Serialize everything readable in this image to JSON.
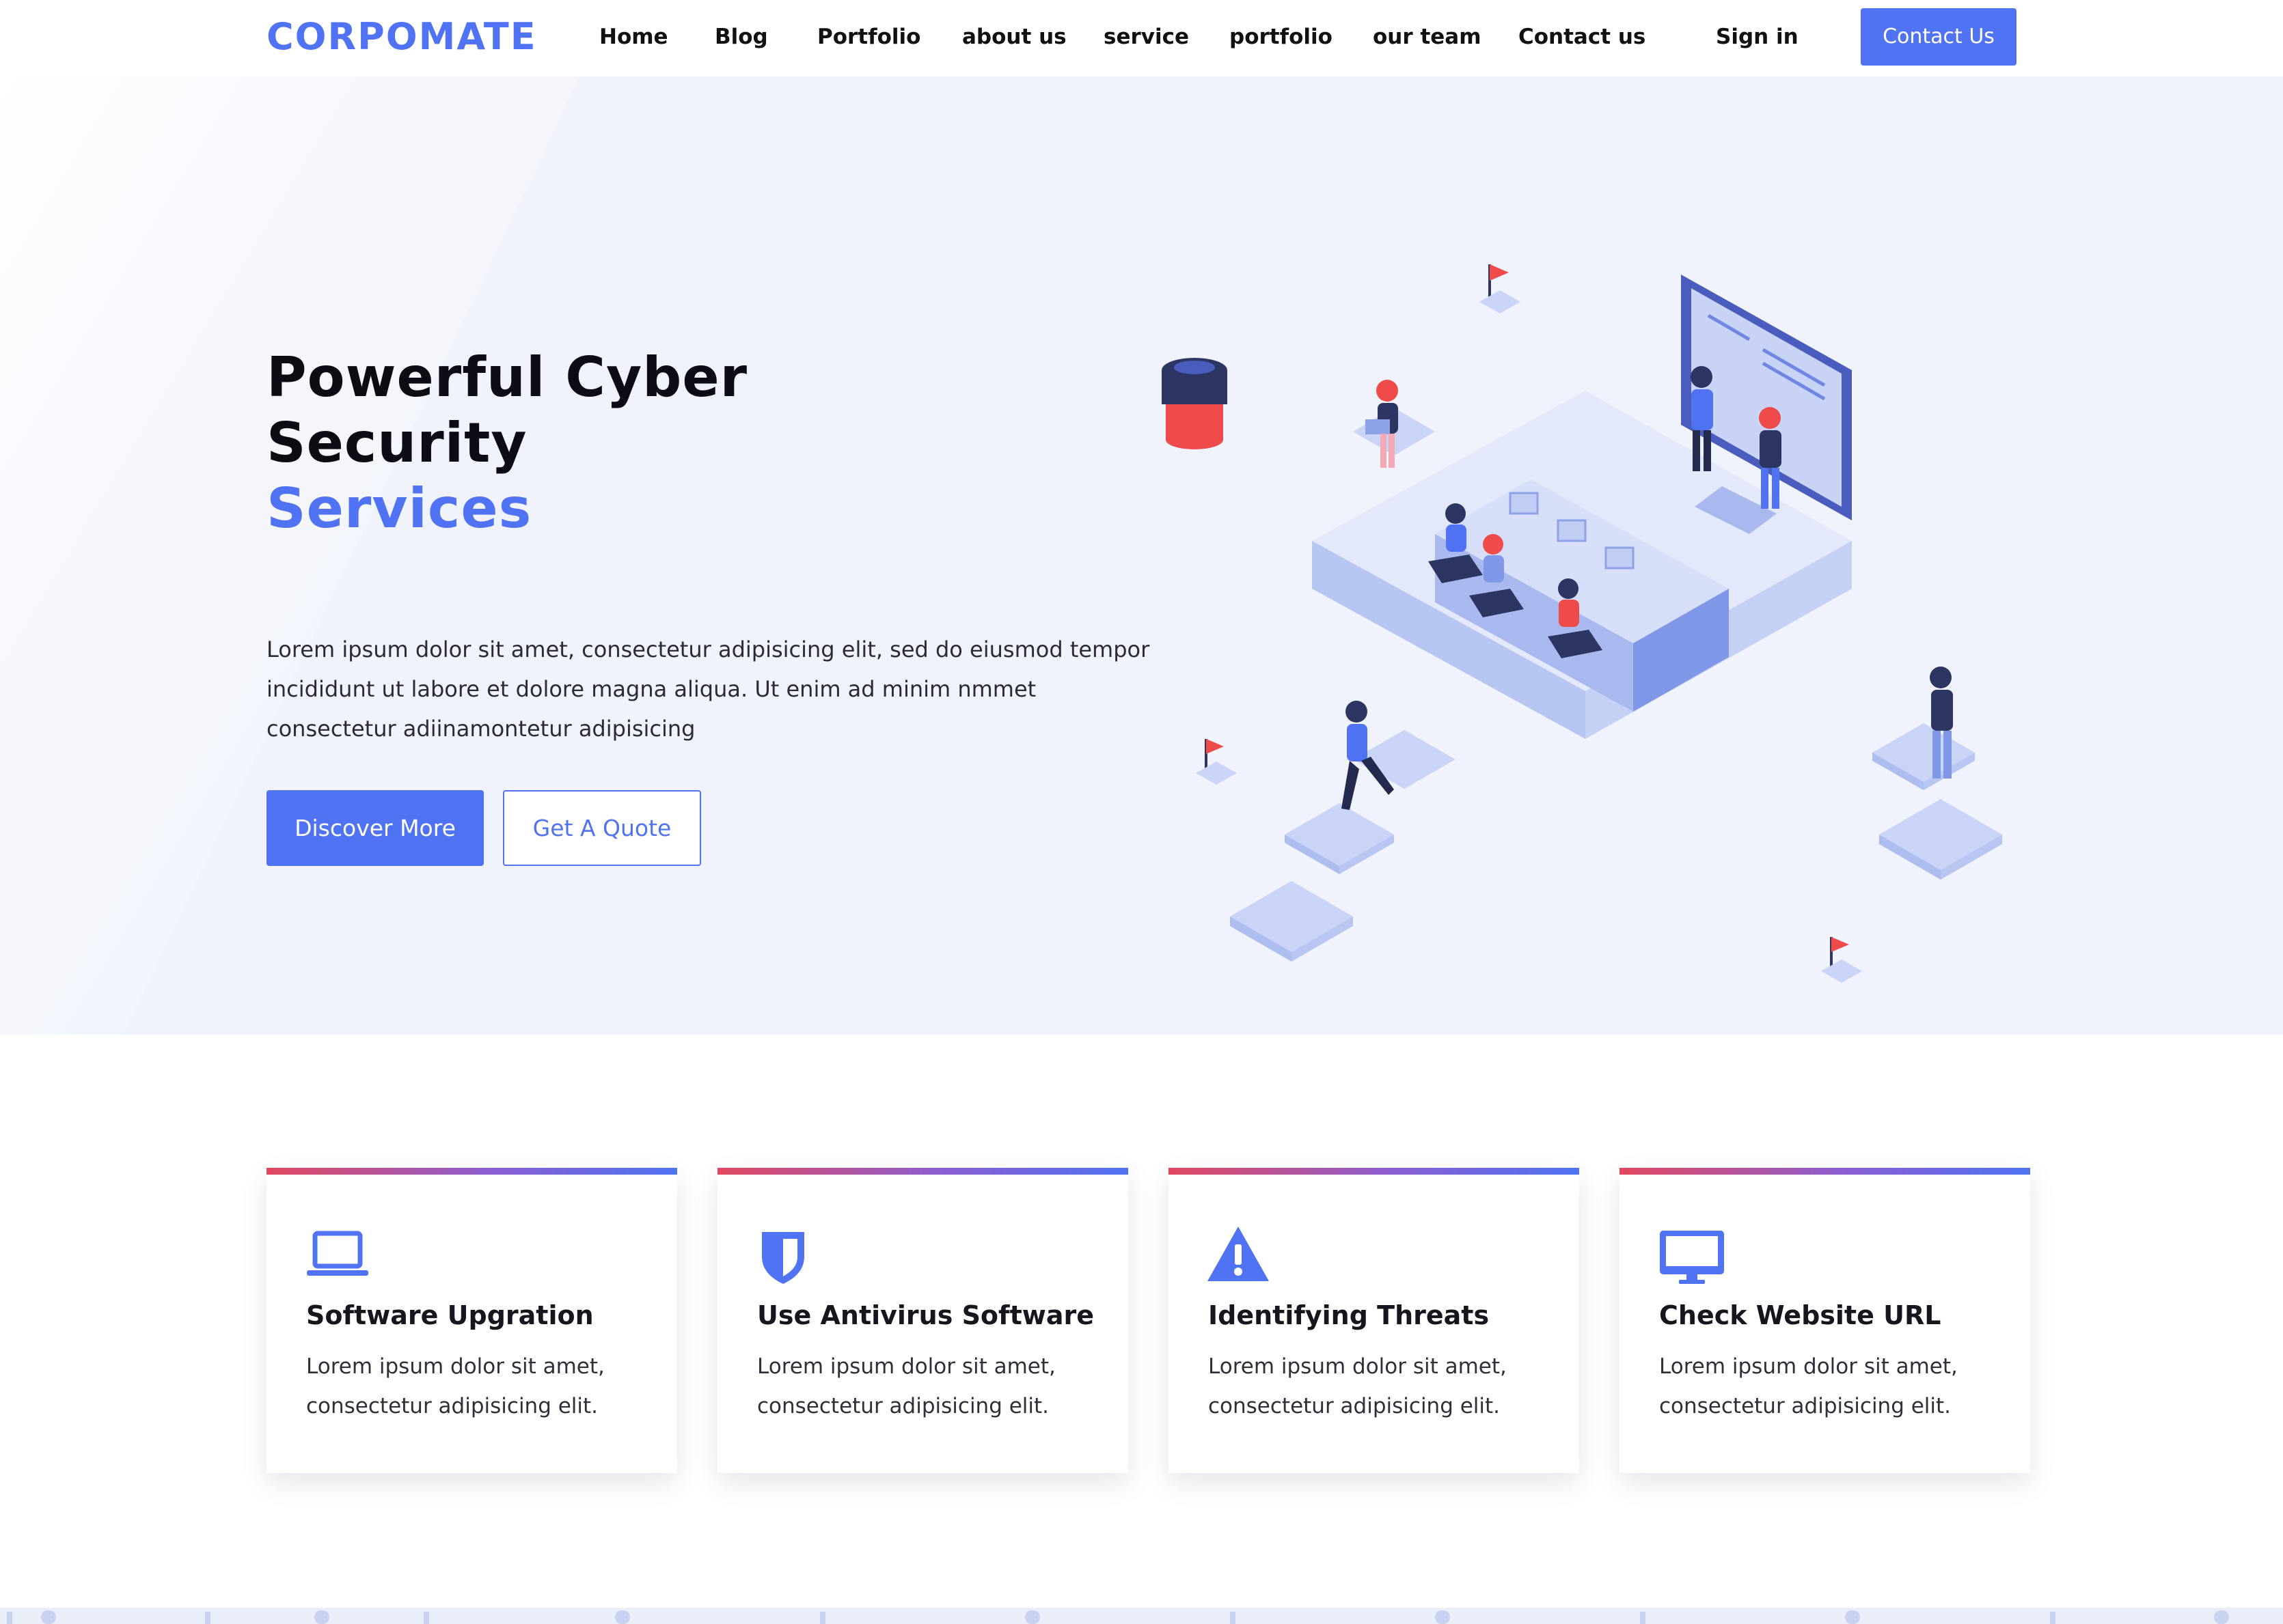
{
  "navbar": {
    "logo": "CORPOMATE",
    "links": [
      "Home",
      "Blog",
      "Portfolio",
      "about us",
      "service",
      "portfolio",
      "our team",
      "Contact us"
    ],
    "sign_in": "Sign in",
    "cta": "Contact Us"
  },
  "hero": {
    "title_line1": "Powerful Cyber",
    "title_line2": "Security",
    "title_accent": "Services",
    "description": "Lorem ipsum dolor sit amet, consectetur adipisicing elit, sed do eiusmod tempor incididunt ut labore et dolore magna aliqua. Ut enim ad minim nmmet consectetur adiinamontetur adipisicing",
    "primary_button": "Discover More",
    "secondary_button": "Get A Quote"
  },
  "features": [
    {
      "icon": "laptop-icon",
      "title": "Software Upgration",
      "text": "Lorem ipsum dolor sit amet, consectetur adipisicing elit."
    },
    {
      "icon": "shield-icon",
      "title": "Use Antivirus Software",
      "text": "Lorem ipsum dolor sit amet, consectetur adipisicing elit."
    },
    {
      "icon": "warning-icon",
      "title": "Identifying Threats",
      "text": "Lorem ipsum dolor sit amet, consectetur adipisicing elit."
    },
    {
      "icon": "monitor-icon",
      "title": "Check Website URL",
      "text": "Lorem ipsum dolor sit amet, consectetur adipisicing elit."
    }
  ],
  "colors": {
    "brand": "#4f73f2",
    "accent_red": "#e2485f",
    "hero_bg": "#f0f3fb"
  }
}
